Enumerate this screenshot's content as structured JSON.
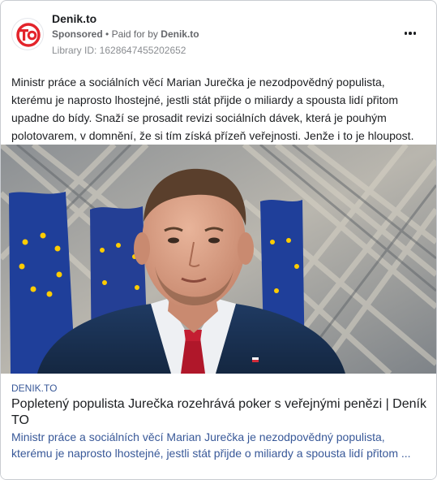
{
  "post": {
    "page_name": "Denik.to",
    "sponsored_label": "Sponsored",
    "separator": "•",
    "paid_for_by_label": "Paid for by",
    "payer_name": "Denik.to",
    "library_id": "Library ID: 1628647455202652",
    "avatar_text": "TO",
    "more_icon": "more-horizontal-icon",
    "body_text": "Ministr práce a sociálních věcí Marian Jurečka je nezodpovědný populista, kterému je naprosto lhostejné, jestli stát přijde o miliardy a spousta lidí přitom upadne do bídy. Snaží se prosadit revizi sociálních dávek, která je pouhým polotovarem, v domnění, že si tím získá přízeň veřejnosti. Jenže i to je hloupost."
  },
  "link": {
    "domain": "DENIK.TO",
    "title": "Popletený populista Jurečka rozehrává poker s veřejnými penězi | Deník TO",
    "description": "Ministr práce a sociálních věcí Marian Jurečka je nezodpovědný populista, kterému je naprosto lhostejné, jestli stát přijde o miliardy a spousta lidí přitom ..."
  },
  "colors": {
    "brand_red": "#e3242b",
    "link_blue": "#385898",
    "eu_blue": "#1f3f9a",
    "eu_star_yellow": "#ffcc00"
  }
}
